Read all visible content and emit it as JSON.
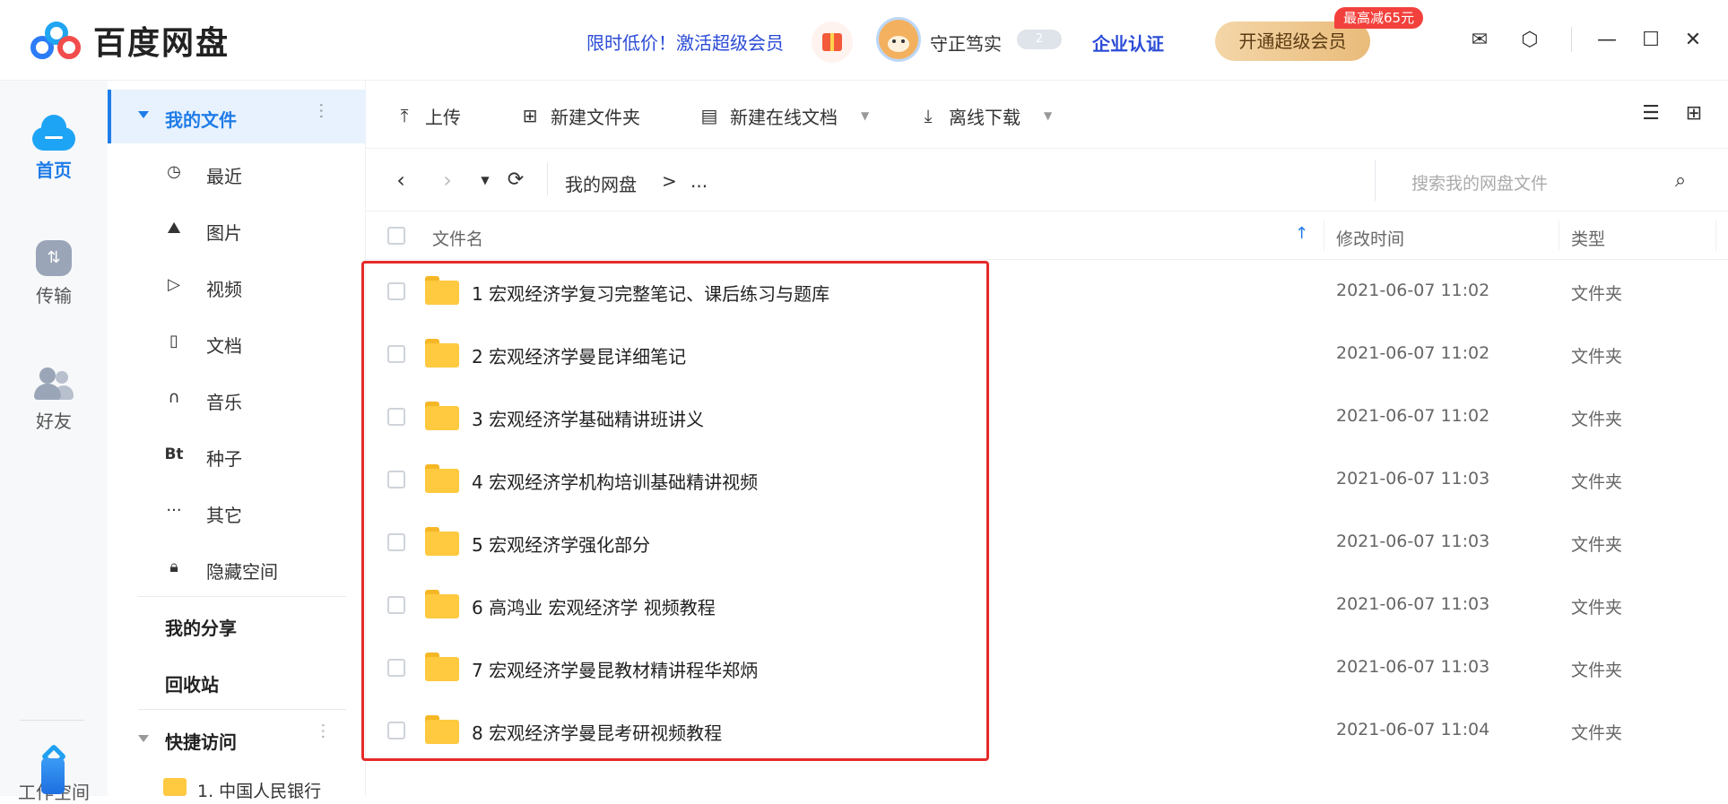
{
  "app": {
    "name": "百度网盘"
  },
  "header": {
    "promo": "限时低价！激活超级会员",
    "username": "守正笃实",
    "level": "2",
    "enterprise": "企业认证",
    "vip_button": "开通超级会员",
    "vip_badge": "最高减65元"
  },
  "leftnav": {
    "items": [
      {
        "label": "首页",
        "icon": "cloud-home-icon"
      },
      {
        "label": "传输",
        "icon": "transfer-icon"
      },
      {
        "label": "好友",
        "icon": "friends-icon"
      },
      {
        "label": "工作空间",
        "icon": "workspace-icon"
      }
    ]
  },
  "sidebar": {
    "title": "我的文件",
    "items": [
      {
        "label": "最近",
        "icon": "clock-icon"
      },
      {
        "label": "图片",
        "icon": "image-icon"
      },
      {
        "label": "视频",
        "icon": "play-icon"
      },
      {
        "label": "文档",
        "icon": "document-icon"
      },
      {
        "label": "音乐",
        "icon": "headphones-icon"
      },
      {
        "label": "种子",
        "icon": "bt-icon",
        "glyph": "Bt"
      },
      {
        "label": "其它",
        "icon": "more-icon"
      },
      {
        "label": "隐藏空间",
        "icon": "lock-icon"
      }
    ],
    "share": "我的分享",
    "recycle": "回收站",
    "quick_access": "快捷访问",
    "quick_item": "1. 中国人民银行"
  },
  "toolbar": {
    "upload": "上传",
    "new_folder": "新建文件夹",
    "new_doc": "新建在线文档",
    "offline_download": "离线下载"
  },
  "path": {
    "root": "我的网盘",
    "sep": ">",
    "rest": "..."
  },
  "search": {
    "placeholder": "搜索我的网盘文件"
  },
  "table": {
    "columns": {
      "name": "文件名",
      "modified": "修改时间",
      "type": "类型"
    },
    "rows": [
      {
        "name": "1 宏观经济学复习完整笔记、课后练习与题库",
        "modified": "2021-06-07 11:02",
        "type": "文件夹"
      },
      {
        "name": "2 宏观经济学曼昆详细笔记",
        "modified": "2021-06-07 11:02",
        "type": "文件夹"
      },
      {
        "name": "3 宏观经济学基础精讲班讲义",
        "modified": "2021-06-07 11:02",
        "type": "文件夹"
      },
      {
        "name": "4 宏观经济学机构培训基础精讲视频",
        "modified": "2021-06-07 11:03",
        "type": "文件夹"
      },
      {
        "name": "5 宏观经济学强化部分",
        "modified": "2021-06-07 11:03",
        "type": "文件夹"
      },
      {
        "name": "6 高鸿业 宏观经济学 视频教程",
        "modified": "2021-06-07 11:03",
        "type": "文件夹"
      },
      {
        "name": "7 宏观经济学曼昆教材精讲程华郑炳",
        "modified": "2021-06-07 11:03",
        "type": "文件夹"
      },
      {
        "name": "8 宏观经济学曼昆考研视频教程",
        "modified": "2021-06-07 11:04",
        "type": "文件夹"
      }
    ]
  },
  "colors": {
    "accent": "#1f7ce8",
    "folder": "#ffc940",
    "highlight": "#e62a2a"
  }
}
